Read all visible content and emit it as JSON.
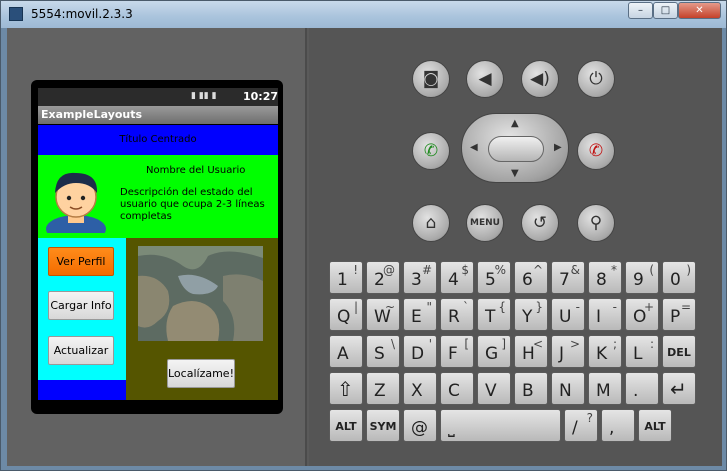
{
  "window": {
    "title": "5554:movil.2.3.3",
    "min_label": "–",
    "max_label": "□",
    "close_label": "✕"
  },
  "device": {
    "status_time": "10:27",
    "status_icons": "▮ ▮▮ ▮",
    "app_title": "ExampleLayouts",
    "header_title": "Título Centrado",
    "user_name": "Nombre del Usuario",
    "user_desc": "Descripción del estado del usuario que ocupa 2-3 líneas completas",
    "buttons": {
      "ver_perfil": "Ver Perfil",
      "cargar_info": "Cargar Info",
      "actualizar": "Actualizar",
      "localizame": "Localízame!"
    }
  },
  "controls": {
    "camera": "◙",
    "vol_down": "◀",
    "vol_up": "◀)",
    "power": "⏻",
    "call": "✆",
    "end_call": "✆",
    "home": "⌂",
    "menu": "MENU",
    "back": "↺",
    "search": "⚲"
  },
  "keyboard": {
    "rows": [
      [
        [
          "1",
          "!"
        ],
        [
          "2",
          "@"
        ],
        [
          "3",
          "#"
        ],
        [
          "4",
          "$"
        ],
        [
          "5",
          "%"
        ],
        [
          "6",
          "^"
        ],
        [
          "7",
          "&"
        ],
        [
          "8",
          "*"
        ],
        [
          "9",
          "("
        ],
        [
          "0",
          ")"
        ]
      ],
      [
        [
          "Q",
          "|"
        ],
        [
          "W",
          "~"
        ],
        [
          "E",
          "\""
        ],
        [
          "R",
          "`"
        ],
        [
          "T",
          "{"
        ],
        [
          "Y",
          "}"
        ],
        [
          "U",
          "-"
        ],
        [
          "I",
          "-"
        ],
        [
          "O",
          "+"
        ],
        [
          "P",
          "="
        ]
      ],
      [
        [
          "A",
          ""
        ],
        [
          "S",
          "\\"
        ],
        [
          "D",
          "'"
        ],
        [
          "F",
          "["
        ],
        [
          "G",
          "]"
        ],
        [
          "H",
          "<"
        ],
        [
          "J",
          ">"
        ],
        [
          "K",
          ";"
        ],
        [
          "L",
          ":"
        ],
        [
          "DEL",
          ""
        ]
      ],
      [
        [
          "⇧",
          ""
        ],
        [
          "Z",
          ""
        ],
        [
          "X",
          ""
        ],
        [
          "C",
          ""
        ],
        [
          "V",
          ""
        ],
        [
          "B",
          ""
        ],
        [
          "N",
          ""
        ],
        [
          "M",
          ""
        ],
        [
          ".",
          ""
        ],
        [
          "↵",
          ""
        ]
      ],
      [
        [
          "ALT",
          ""
        ],
        [
          "SYM",
          ""
        ],
        [
          "@",
          ""
        ],
        [
          "␣",
          ""
        ],
        [
          "/",
          "?"
        ],
        [
          ",",
          ""
        ],
        [
          "ALT",
          ""
        ]
      ]
    ]
  }
}
